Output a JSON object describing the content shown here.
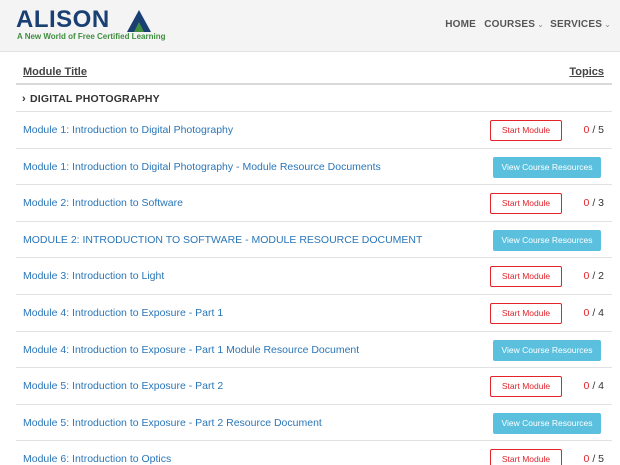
{
  "header": {
    "logo_text": "ALISON",
    "logo_tagline": "A New World of Free Certified Learning",
    "nav": [
      {
        "label": "HOME"
      },
      {
        "label": "COURSES",
        "icon": "chevron-down-icon"
      },
      {
        "label": "SERVICES",
        "icon": "chevron-down-icon"
      }
    ]
  },
  "colors": {
    "link": "#2a76b8",
    "start_button": "#e2232a",
    "resources_button": "#5bc0de",
    "logo_blue": "#1a3f73",
    "logo_green": "#3f8f3f"
  },
  "table": {
    "col_title": "Module Title",
    "col_topics": "Topics",
    "section": "DIGITAL PHOTOGRAPHY",
    "rows": [
      {
        "title": "Module 1: Introduction to Digital Photography",
        "action": "Start Module",
        "completed": "0",
        "total": "/ 5"
      },
      {
        "title": "Module 1: Introduction to Digital Photography - Module Resource Documents",
        "action": "View Course Resources"
      },
      {
        "title": "Module 2: Introduction to Software",
        "action": "Start Module",
        "completed": "0",
        "total": "/ 3"
      },
      {
        "title": "MODULE 2: INTRODUCTION TO SOFTWARE - MODULE RESOURCE DOCUMENT",
        "action": "View Course Resources"
      },
      {
        "title": "Module 3: Introduction to Light",
        "action": "Start Module",
        "completed": "0",
        "total": "/ 2"
      },
      {
        "title": "Module 4: Introduction to Exposure - Part 1",
        "action": "Start Module",
        "completed": "0",
        "total": "/ 4"
      },
      {
        "title": "Module 4: Introduction to Exposure - Part 1 Module Resource Document",
        "action": "View Course Resources"
      },
      {
        "title": "Module 5: Introduction to Exposure - Part 2",
        "action": "Start Module",
        "completed": "0",
        "total": "/ 4"
      },
      {
        "title": "Module 5: Introduction to Exposure - Part 2 Resource Document",
        "action": "View Course Resources"
      },
      {
        "title": "Module 6: Introduction to Optics",
        "action": "Start Module",
        "completed": "0",
        "total": "/ 5"
      }
    ]
  }
}
